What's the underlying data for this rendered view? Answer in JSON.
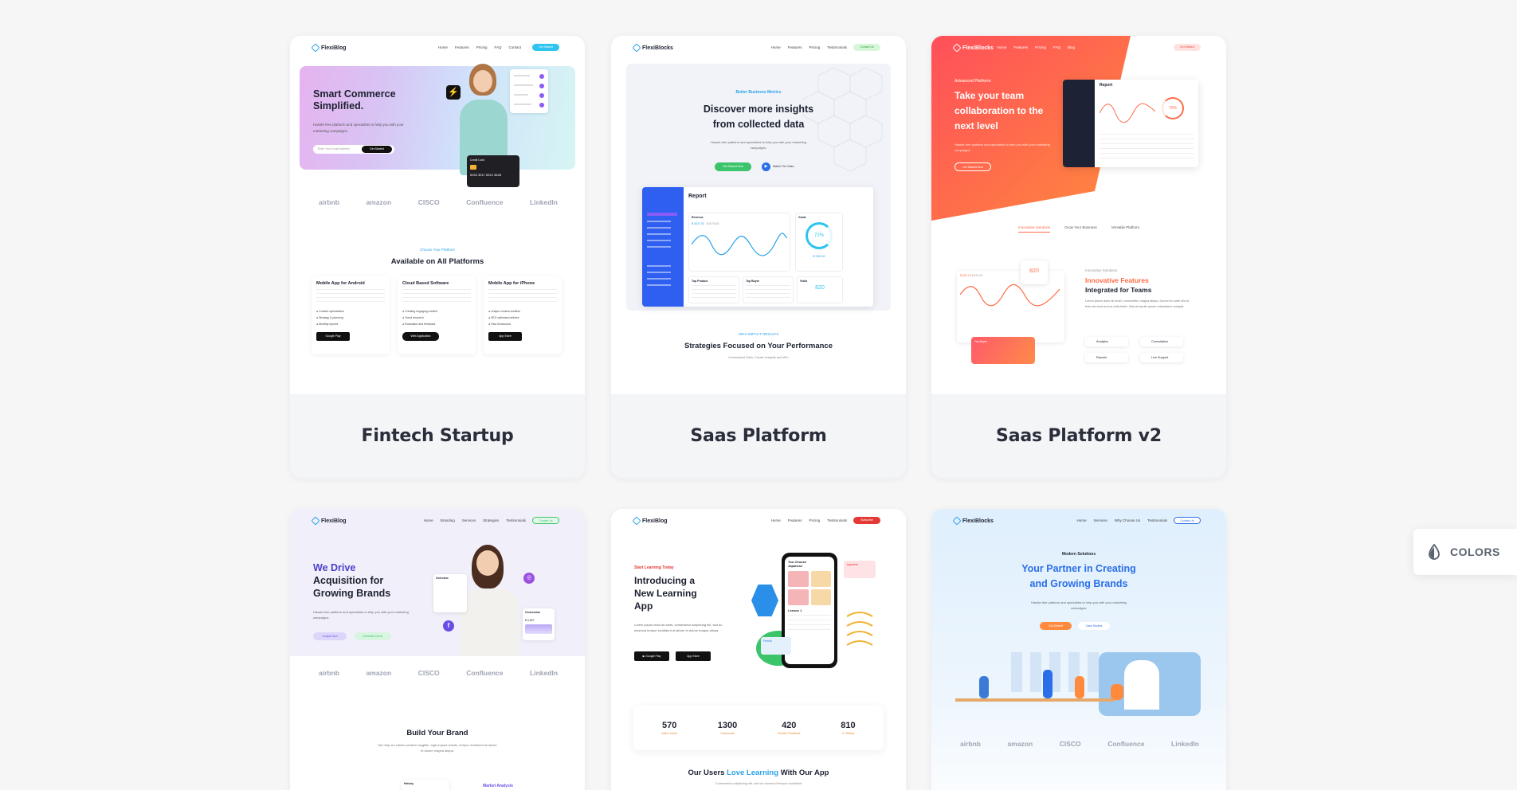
{
  "cards": [
    {
      "title": "Fintech Startup"
    },
    {
      "title": "Saas Platform"
    },
    {
      "title": "Saas Platform v2"
    },
    {
      "title": ""
    },
    {
      "title": ""
    },
    {
      "title": ""
    }
  ],
  "c1": {
    "logo": "FlexiBlog",
    "nav": [
      "Home",
      "Features",
      "Pricing",
      "FAQ",
      "Contact"
    ],
    "cta": "Get Started",
    "hero_title": "Smart Commerce Simplified.",
    "hero_sub": "Hassle-free platform and specialists to help you with your marketing campaigns.",
    "email_placeholder": "Enter Your Email Address",
    "hero_btn": "Get Started",
    "card_number": "5254 3017 6512 3648",
    "card_label": "Credit Card",
    "logos": [
      "airbnb",
      "amazon",
      "CISCO",
      "Confluence",
      "LinkedIn"
    ],
    "kicker": "Choose Your Platform",
    "section_title": "Available on All Platforms",
    "features": [
      {
        "title": "Mobile App for Android",
        "items": [
          "Content optimization",
          "Strategy & planning",
          "Monthly reports"
        ],
        "btn": "Google Play"
      },
      {
        "title": "Cloud Based Software",
        "items": [
          "Creating engaging content",
          "Trend research",
          "Evaluation and feedback"
        ],
        "btn": "Web Application"
      },
      {
        "title": "Mobile App for iPhone",
        "items": [
          "Unique content creation",
          "SEO optimized articles",
          "Fast turnaround"
        ],
        "btn": "App Store"
      }
    ]
  },
  "c2": {
    "logo": "FlexiBlocks",
    "nav": [
      "Home",
      "Features",
      "Pricing",
      "Testimonials"
    ],
    "cta": "Contact Us",
    "kicker": "Better Business Metrics",
    "hero_title": "Discover more insights from collected data",
    "hero_sub": "Hassle-free platform and specialists to help you with your marketing campaigns.",
    "btn1": "Get Started Now",
    "btn2": "Watch The Video",
    "report_title": "Report",
    "revenue_label": "Revenue",
    "revenue_1": "$ 823.76",
    "revenue_2": "$ 679.00",
    "goals_label": "Goals",
    "goal_pct": "72%",
    "goal_val": "$ 900.52",
    "top_product": "Top Product",
    "top_buyer": "Top Buyer",
    "visits": "Visits",
    "visits_num": "820",
    "kicker2": "HIGH IMPACT RESULTS",
    "section_title": "Strategies Focused on Your Performance",
    "section_sub": "Understand Data, Create Insights and Win"
  },
  "c3": {
    "logo": "FlexiBlocks",
    "nav": [
      "Home",
      "Features",
      "Pricing",
      "FAQ",
      "Blog"
    ],
    "cta": "Get Started",
    "kicker": "Advanced Platform",
    "hero_title": "Take your team collaboration to the next level",
    "hero_sub": "Hassle-free platform and specialists to help you with your marketing campaigns.",
    "btn": "Get Started Now",
    "report_title": "Report",
    "tabs": [
      "Innovative Solutions",
      "Grow Your Business",
      "Versatile Platform"
    ],
    "visits_num": "820",
    "pill_text": "Top Buyer",
    "kicker2": "Innovative Solutions",
    "feat_title_1": "Innovative Features",
    "feat_title_2": "Integrated for Teams",
    "feat_sub": "Lorem ipsum dolor sit amet, consectetur magna aliqua. Donec leo ante ullo et, felis nisi viverra eros sollicitudin. Mauris iaculis ipsum voluptatem volutpat.",
    "chips": [
      "Analytics",
      "Consultation",
      "Reports",
      "Live Support"
    ],
    "revenue": "$ 823.76",
    "revenue2": "$ 679.00",
    "pct": "70%"
  },
  "c4": {
    "logo": "FlexiBlog",
    "nav": [
      "Home",
      "Branding",
      "Services",
      "Strategies",
      "Testimonials"
    ],
    "cta": "Contact Us",
    "hero_title_1": "We Drive",
    "hero_title_2": "Acquisition for",
    "hero_title_3": "Growing Brands",
    "hero_sub": "Hassle-free platform and specialists to help you with your marketing campaigns.",
    "btn1": "Unique Now",
    "btn2": "Schedule Demo",
    "overview": "Overview",
    "conversion": "Conversion",
    "conv_val": "$ 9,847",
    "logos": [
      "airbnb",
      "amazon",
      "CISCO",
      "Confluence",
      "LinkedIn"
    ],
    "section_title": "Build Your Brand",
    "section_sub": "We help our clients achieve tangible, high-impact results, tempor incididunt ut labore et dolore magna aliqua.",
    "history": "History",
    "market": "Market Analysis"
  },
  "c5": {
    "logo": "FlexiBlog",
    "nav": [
      "Home",
      "Features",
      "Pricing",
      "Testimonials"
    ],
    "cta": "Subscribe",
    "kicker": "Start Learning Today",
    "hero_title": "Introducing a New Learning App",
    "hero_sub": "Lorem ipsum dolor sit amet, consectetur adipiscing elit, sed do eiusmod tempor incididunt ut labore et dolore magna aliqua.",
    "phone_title": "You Choose Japanese",
    "phone_lesson": "Lesson 1",
    "japanese_label": "Japanese",
    "french_label": "French",
    "stats": [
      {
        "num": "570",
        "label": "Active Users"
      },
      {
        "num": "1300",
        "label": "Downloads"
      },
      {
        "num": "420",
        "label": "Positive Feedback"
      },
      {
        "num": "810",
        "label": "4+ Rating"
      }
    ],
    "section_pre": "Our Users",
    "section_hl": "Love Learning",
    "section_post": "With Our App",
    "section_sub": "Consectetur adipiscing elit, sed do eiusmod tempor incididunt"
  },
  "c6": {
    "logo": "FlexiBlocks",
    "nav": [
      "Home",
      "Services",
      "Why Choose Us",
      "Testimonials"
    ],
    "cta": "Contact Us",
    "kicker": "Modern Solutions",
    "hero_title_1": "Your Partner in Creating",
    "hero_title_2": "and Growing Brands",
    "hero_sub": "Hassle-free platform and specialists to help you with your marketing campaigns.",
    "btn1": "Get Started",
    "btn2": "Case Studies",
    "logos": [
      "airbnb",
      "amazon",
      "CISCO",
      "Confluence",
      "LinkedIn"
    ]
  },
  "colors_btn": "COLORS",
  "accent": {
    "blue": "#2aa3e8",
    "orange": "#ff6b47",
    "purple": "#6b4ee6",
    "red": "#e53935",
    "green": "#3cc46b"
  }
}
